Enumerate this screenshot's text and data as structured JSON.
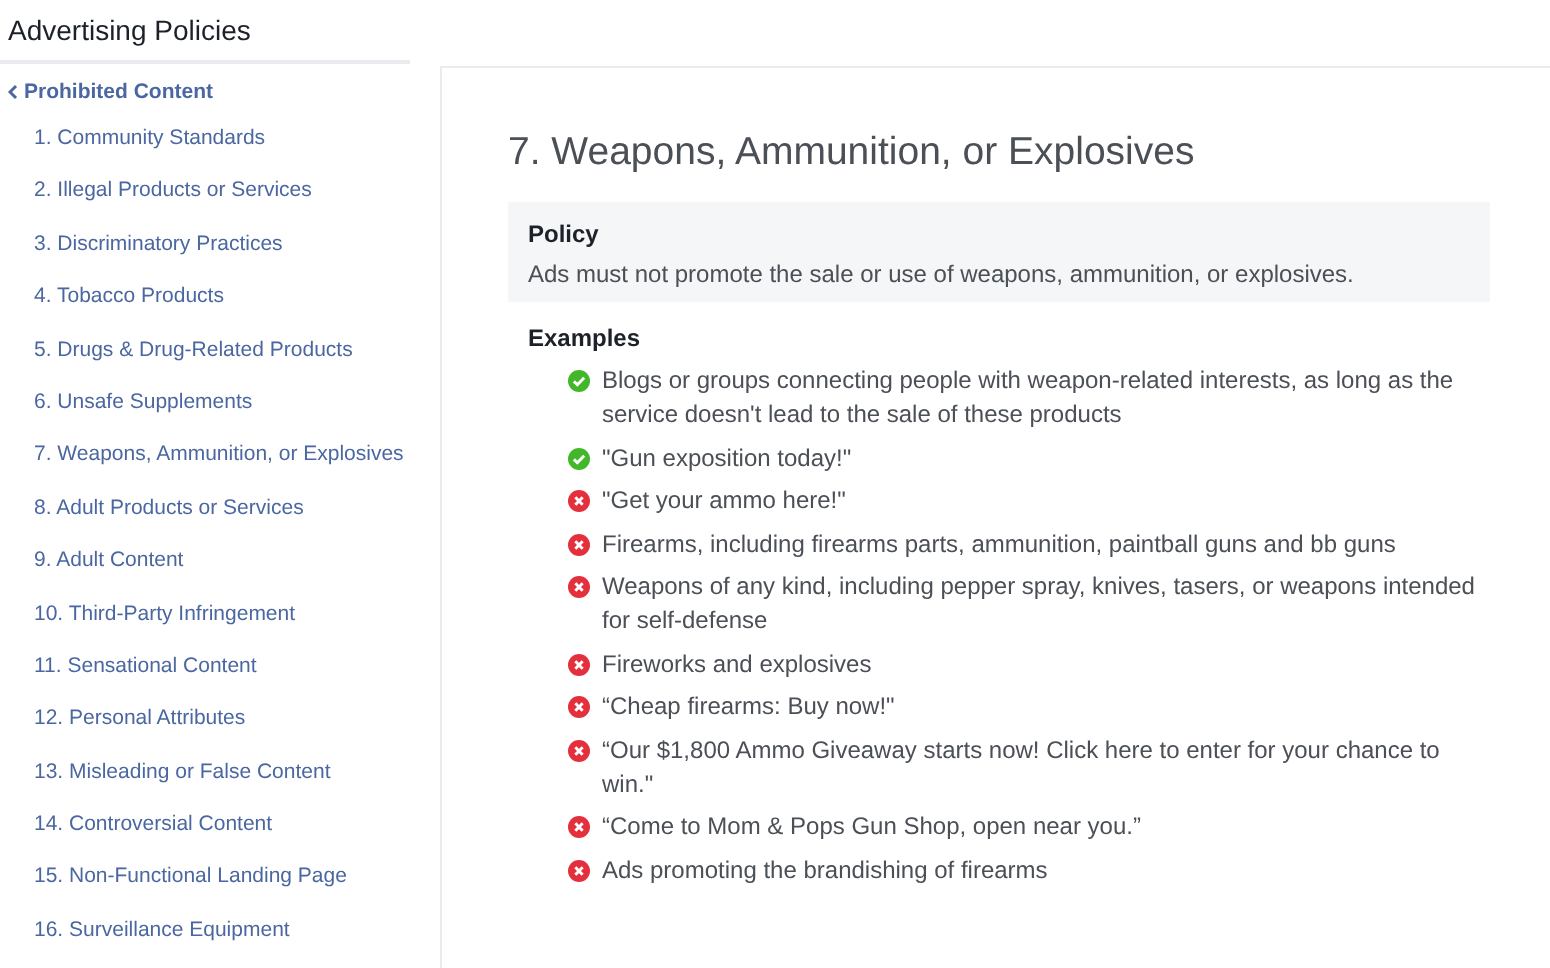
{
  "header": {
    "title": "Advertising Policies"
  },
  "sidebar": {
    "back_link": "Prohibited Content",
    "items": [
      {
        "label": "1. Community Standards"
      },
      {
        "label": "2. Illegal Products or Services"
      },
      {
        "label": "3. Discriminatory Practices"
      },
      {
        "label": "4. Tobacco Products"
      },
      {
        "label": "5. Drugs & Drug-Related Products"
      },
      {
        "label": "6. Unsafe Supplements"
      },
      {
        "label": "7. Weapons, Ammunition, or Explosives"
      },
      {
        "label": "8. Adult Products or Services"
      },
      {
        "label": "9. Adult Content"
      },
      {
        "label": "10. Third-Party Infringement"
      },
      {
        "label": "11. Sensational Content"
      },
      {
        "label": "12. Personal Attributes"
      },
      {
        "label": "13. Misleading or False Content"
      },
      {
        "label": "14. Controversial Content"
      },
      {
        "label": "15. Non-Functional Landing Page"
      },
      {
        "label": "16. Surveillance Equipment"
      }
    ]
  },
  "main": {
    "title": "7. Weapons, Ammunition, or Explosives",
    "policy": {
      "heading": "Policy",
      "text": "Ads must not promote the sale or use of weapons, ammunition, or explosives."
    },
    "examples": {
      "heading": "Examples",
      "items": [
        {
          "kind": "allowed",
          "text": "Blogs or groups connecting people with weapon-related interests, as long as the service doesn't lead to the sale of these products"
        },
        {
          "kind": "allowed",
          "text": "\"Gun exposition today!\""
        },
        {
          "kind": "prohibited",
          "text": "\"Get your ammo here!\""
        },
        {
          "kind": "prohibited",
          "text": "Firearms, including firearms parts, ammunition, paintball guns and bb guns"
        },
        {
          "kind": "prohibited",
          "text": "Weapons of any kind, including pepper spray, knives, tasers, or weapons intended for self-defense"
        },
        {
          "kind": "prohibited",
          "text": "Fireworks and explosives"
        },
        {
          "kind": "prohibited",
          "text": "“Cheap firearms: Buy now!\""
        },
        {
          "kind": "prohibited",
          "text": "“Our $1,800 Ammo Giveaway starts now! Click here to enter for your chance to win.\""
        },
        {
          "kind": "prohibited",
          "text": "“Come to Mom & Pops Gun Shop, open near you.”"
        },
        {
          "kind": "prohibited",
          "text": "Ads promoting the brandishing of firearms"
        }
      ]
    }
  }
}
